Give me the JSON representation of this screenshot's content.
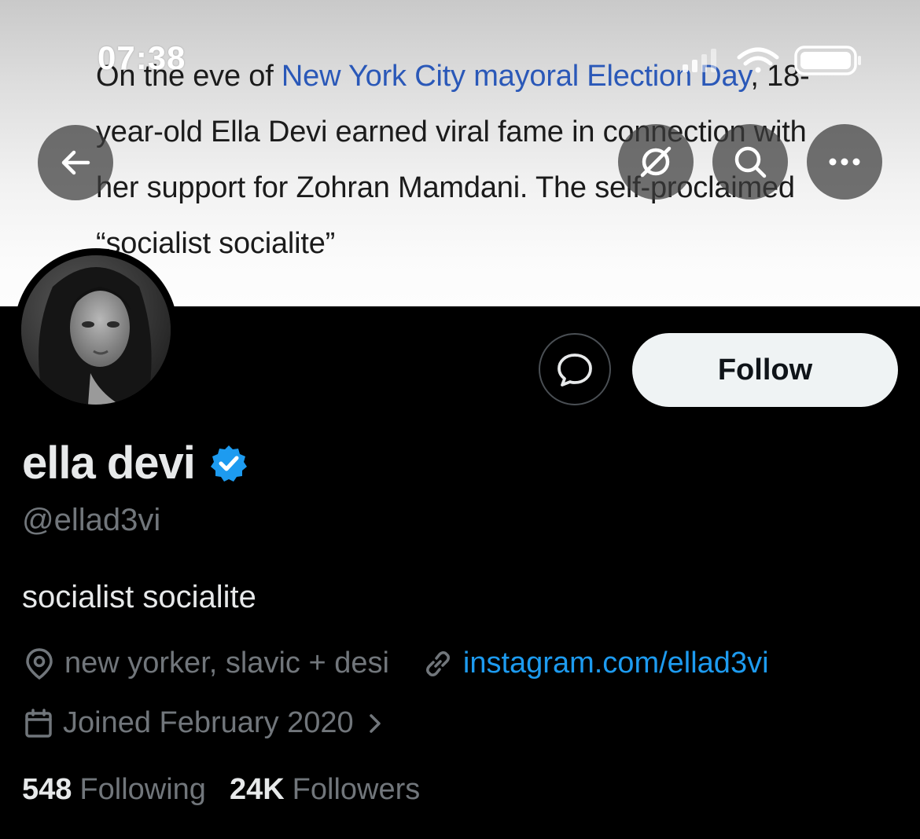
{
  "status_bar": {
    "time": "07:38"
  },
  "banner": {
    "text_before_link": "On the eve of ",
    "link_text": "New York City mayoral Election Day",
    "text_after_link": ", 18-year-old Ella Devi earned viral fame in connection with her support for Zohran Mamdani. The self-proclaimed “socialist socialite”"
  },
  "nav": {
    "back_icon": "arrow-left-icon",
    "grok_icon": "grok-icon",
    "search_icon": "search-icon",
    "more_icon": "more-horizontal-icon"
  },
  "actions": {
    "message_icon": "message-bubble-icon",
    "follow_label": "Follow"
  },
  "profile": {
    "display_name": "ella devi",
    "handle": "@ellad3vi",
    "bio": "socialist socialite",
    "location": "new yorker, slavic + desi",
    "website": "instagram.com/ellad3vi",
    "joined": "Joined February 2020",
    "following_count": "548",
    "following_label": "Following",
    "followers_count": "24K",
    "followers_label": "Followers"
  },
  "colors": {
    "accent": "#1d9bf0",
    "verified": "#1d9bf0",
    "link_in_banner": "#2a58b8"
  }
}
